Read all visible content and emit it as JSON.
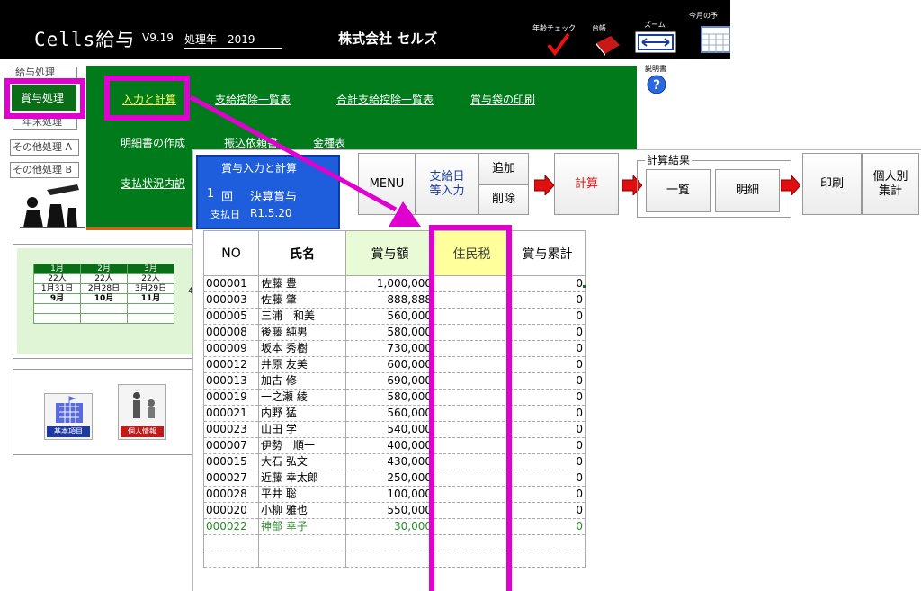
{
  "header": {
    "app_title": "Cells給与",
    "version": "V9.19",
    "year_label": "処理年　2019",
    "company": "株式会社 セルズ",
    "toolbar": [
      {
        "label": "年齢チェック",
        "icon": "check-icon"
      },
      {
        "label": "台帳",
        "icon": "ledger-book-icon"
      },
      {
        "label": "ズーム",
        "icon": "zoom-width-icon"
      },
      {
        "label": "今月の予",
        "icon": "calendar-icon"
      }
    ],
    "help_label": "説明書"
  },
  "left_menu": {
    "items": [
      "給与処理",
      "賞与処理",
      "年末処理",
      "その他処理 A",
      "その他処理 B"
    ],
    "active": "賞与処理"
  },
  "green_panel": {
    "row1": [
      "入力と計算",
      "支給控除一覧表",
      "合計支給控除一覧表",
      "賞与袋の印刷"
    ],
    "row2": [
      "明細書の作成",
      "振込依頼書",
      "金種表"
    ],
    "row3": [
      "支払状況内訳"
    ]
  },
  "calendar": {
    "months": [
      "1月",
      "2月",
      "3月"
    ],
    "counts": [
      "22人",
      "22人",
      "22人"
    ],
    "dates": [
      "1月31日",
      "2月28日",
      "3月29日"
    ],
    "next_months": [
      "9月",
      "10月",
      "11月"
    ],
    "cut_digit": "4"
  },
  "icons_panel": {
    "items": [
      {
        "label": "基本項目",
        "icon": "building-icon"
      },
      {
        "label": "個人情報",
        "icon": "person-icon"
      }
    ]
  },
  "dialog": {
    "title": "賞与入力と計算",
    "round_no": "1",
    "round_unit": "回",
    "bonus_name": "決算賞与",
    "pay_date_label": "支払日",
    "pay_date": "R1.5.20",
    "buttons": {
      "menu": "MENU",
      "pay_date_input": [
        "支給日",
        "等入力"
      ],
      "add": "追加",
      "delete": "削除",
      "calc": "計算",
      "result_group": "計算結果",
      "list": "一覧",
      "detail": "明細",
      "print": "印刷",
      "individual": [
        "個人別",
        "集計"
      ]
    },
    "colors": {
      "accent": "#e000d0",
      "title_bg": "#1e5ddc",
      "highlight_col": "#ffff9c"
    }
  },
  "table": {
    "headers": [
      "NO",
      "氏名",
      "賞与額",
      "住民税",
      "賞与累計"
    ],
    "rows": [
      {
        "no": "000001",
        "name": "佐藤 豊",
        "amount": "1,000,000",
        "tax": "",
        "total": "0"
      },
      {
        "no": "000003",
        "name": "佐藤 肇",
        "amount": "888,888",
        "tax": "",
        "total": "0"
      },
      {
        "no": "000005",
        "name": "三浦　和美",
        "amount": "560,000",
        "tax": "",
        "total": "0"
      },
      {
        "no": "000008",
        "name": "後藤 純男",
        "amount": "580,000",
        "tax": "",
        "total": "0"
      },
      {
        "no": "000009",
        "name": "坂本 秀樹",
        "amount": "730,000",
        "tax": "",
        "total": "0"
      },
      {
        "no": "000012",
        "name": "井原 友美",
        "amount": "600,000",
        "tax": "",
        "total": "0"
      },
      {
        "no": "000013",
        "name": "加古 修",
        "amount": "690,000",
        "tax": "",
        "total": "0"
      },
      {
        "no": "000019",
        "name": "一之瀬 綾",
        "amount": "580,000",
        "tax": "",
        "total": "0"
      },
      {
        "no": "000021",
        "name": "内野 猛",
        "amount": "560,000",
        "tax": "",
        "total": "0"
      },
      {
        "no": "000023",
        "name": "山田 学",
        "amount": "540,000",
        "tax": "",
        "total": "0"
      },
      {
        "no": "000007",
        "name": "伊勢　順一",
        "amount": "400,000",
        "tax": "",
        "total": "0"
      },
      {
        "no": "000015",
        "name": "大石 弘文",
        "amount": "430,000",
        "tax": "",
        "total": "0"
      },
      {
        "no": "000027",
        "name": "近藤 幸太郎",
        "amount": "250,000",
        "tax": "",
        "total": "0"
      },
      {
        "no": "000028",
        "name": "平井 聡",
        "amount": "100,000",
        "tax": "",
        "total": "0"
      },
      {
        "no": "000020",
        "name": "小柳 雅也",
        "amount": "550,000",
        "tax": "",
        "total": "0"
      },
      {
        "no": "000022",
        "name": "神部 幸子",
        "amount": "30,000",
        "tax": "",
        "total": "0"
      }
    ]
  }
}
